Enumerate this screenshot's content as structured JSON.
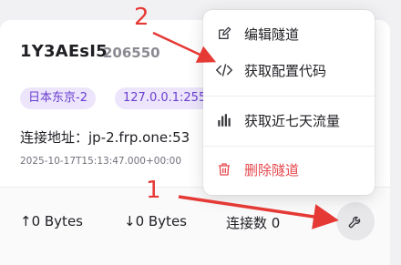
{
  "tunnel": {
    "name": "1Y3AEsI5",
    "id": "206550",
    "tags": {
      "region": "日本东京-2",
      "ip": "127.0.0.1:255"
    },
    "address": "连接地址：jp-2.frp.one:53",
    "created_at": "2025-10-17T15:13:47.000+00:00"
  },
  "stats": {
    "upload": "0 Bytes",
    "download": "0 Bytes",
    "connections": "连接数 0"
  },
  "menu": {
    "items": [
      {
        "label": "编辑隧道",
        "icon": "edit-icon"
      },
      {
        "label": "获取配置代码",
        "icon": "code-icon"
      },
      {
        "label": "获取近七天流量",
        "icon": "bar-chart-icon"
      },
      {
        "label": "删除隧道",
        "icon": "trash-icon"
      }
    ]
  },
  "annotations": {
    "marker_1": "1",
    "marker_2": "2"
  },
  "colors": {
    "accent": "#6b3fd0",
    "danger": "#e5484d",
    "annotation": "#e53935"
  }
}
